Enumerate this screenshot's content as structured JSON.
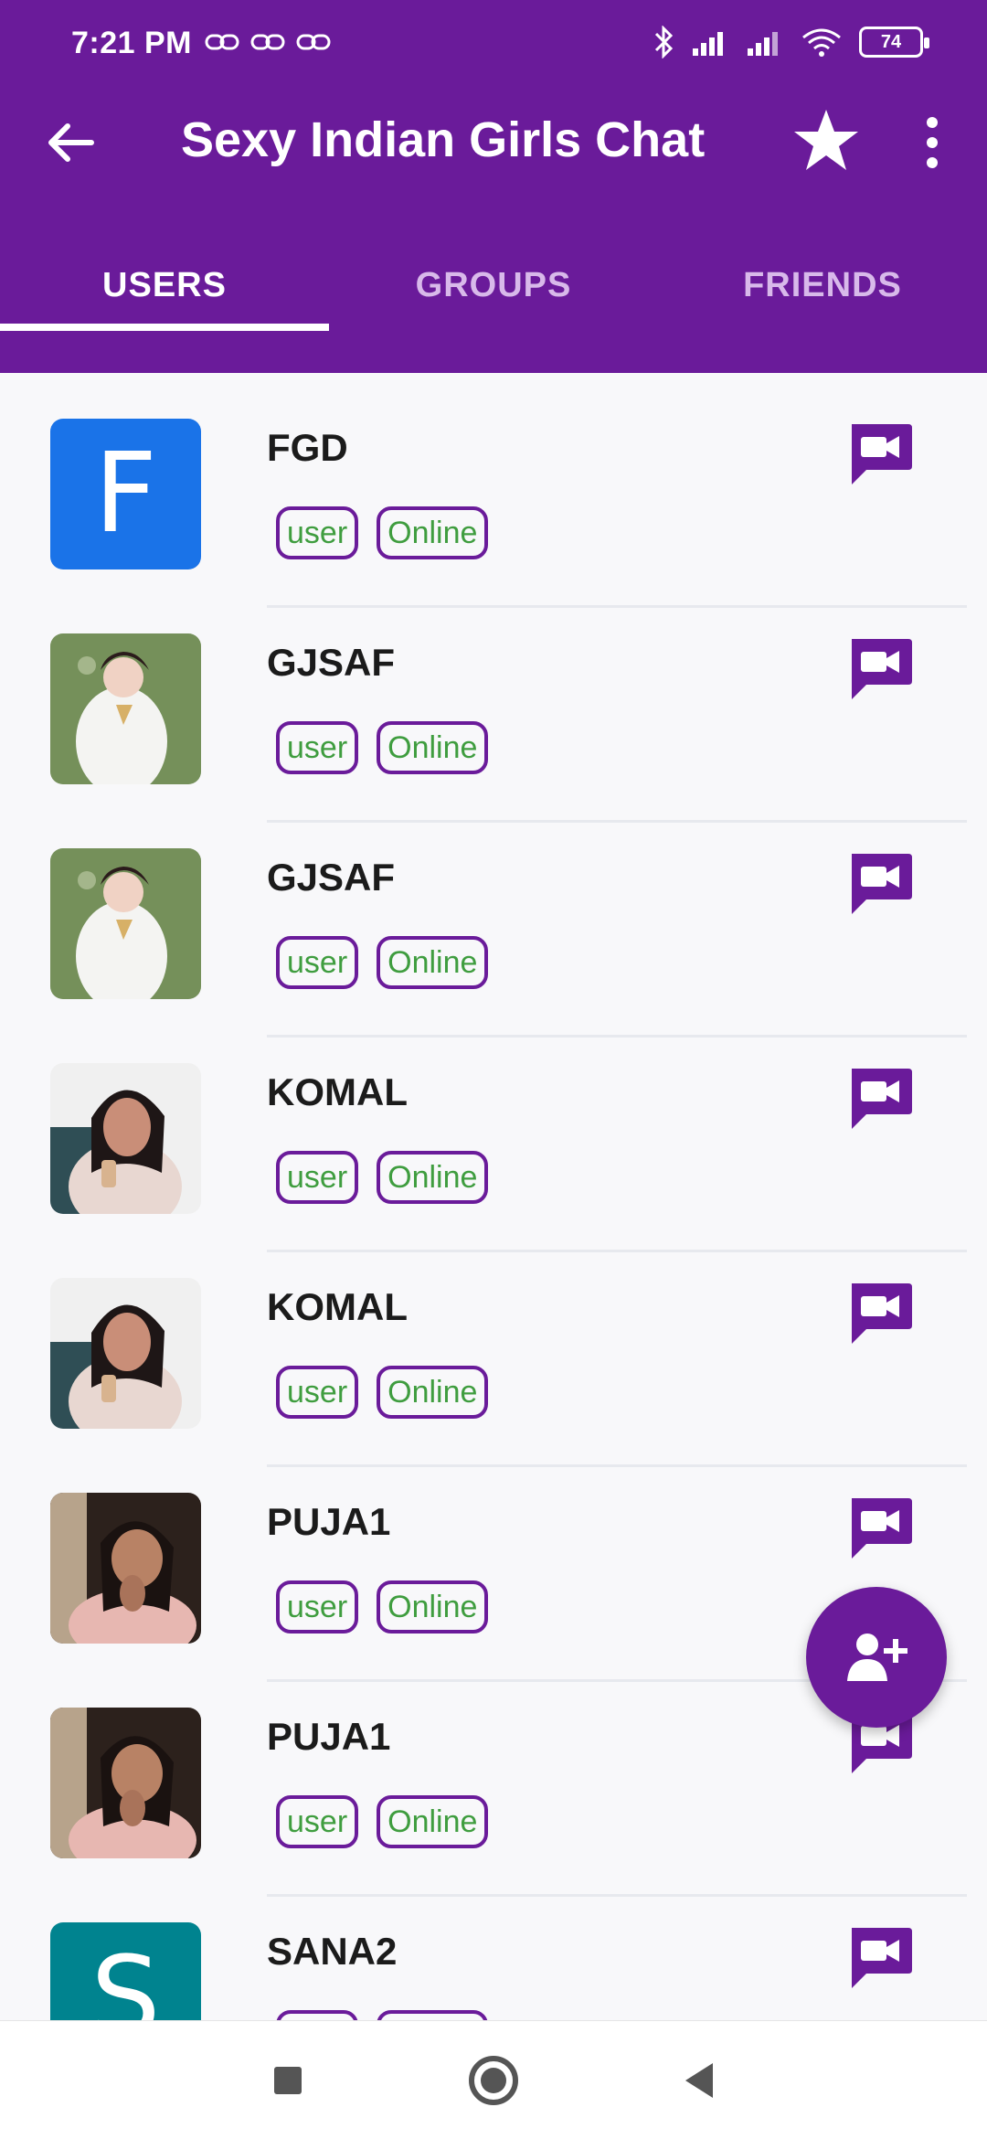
{
  "status_bar": {
    "time": "7:21 PM",
    "battery": "74",
    "icons": [
      "link-icon",
      "link-icon",
      "link-icon",
      "bluetooth-icon",
      "signal-icon",
      "signal-icon",
      "wifi-icon",
      "battery-icon"
    ]
  },
  "app_bar": {
    "title": "Sexy Indian Girls Chat",
    "back_icon": "arrow-left-icon",
    "star_icon": "star-icon",
    "more_icon": "more-vertical-icon"
  },
  "tabs": [
    {
      "label": "USERS",
      "active": true
    },
    {
      "label": "GROUPS",
      "active": false
    },
    {
      "label": "FRIENDS",
      "active": false
    }
  ],
  "users": [
    {
      "name": "FGD",
      "role": "user",
      "status": "Online",
      "avatar": {
        "type": "letter",
        "letter": "F",
        "color": "#1a73e8"
      }
    },
    {
      "name": "GJSAF",
      "role": "user",
      "status": "Online",
      "avatar": {
        "type": "photo"
      }
    },
    {
      "name": "GJSAF",
      "role": "user",
      "status": "Online",
      "avatar": {
        "type": "photo"
      }
    },
    {
      "name": "KOMAL",
      "role": "user",
      "status": "Online",
      "avatar": {
        "type": "photo"
      }
    },
    {
      "name": "KOMAL",
      "role": "user",
      "status": "Online",
      "avatar": {
        "type": "photo"
      }
    },
    {
      "name": "PUJA1",
      "role": "user",
      "status": "Online",
      "avatar": {
        "type": "photo"
      }
    },
    {
      "name": "PUJA1",
      "role": "user",
      "status": "Online",
      "avatar": {
        "type": "photo"
      }
    },
    {
      "name": "SANA2",
      "role": "user",
      "status": "Online",
      "avatar": {
        "type": "letter",
        "letter": "S",
        "color": "#00838f"
      }
    }
  ],
  "fab": {
    "icon": "add-user-icon"
  },
  "nav_bar": {
    "icons": [
      "square-icon",
      "home-circle-icon",
      "back-triangle-icon"
    ]
  },
  "colors": {
    "primary": "#6a1b9a",
    "online_text": "#3f9d3f",
    "tab_inactive": "#d8b9ea"
  }
}
